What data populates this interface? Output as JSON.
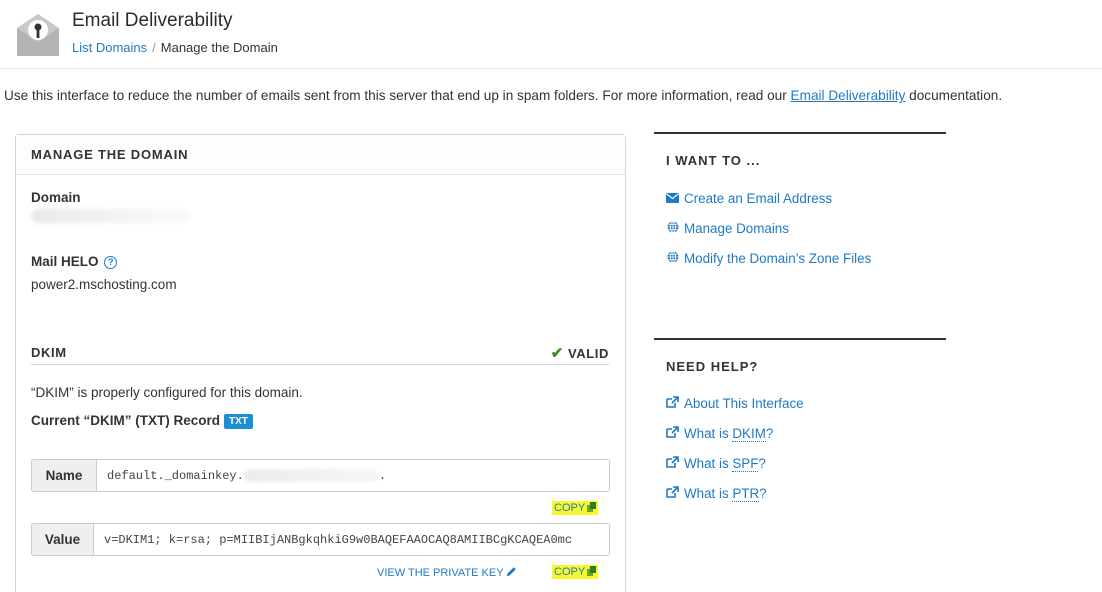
{
  "header": {
    "title": "Email Deliverability",
    "breadcrumb": {
      "link": "List Domains",
      "separator": "/",
      "current": "Manage the Domain"
    }
  },
  "intro": {
    "text_before": "Use this interface to reduce the number of emails sent from this server that end up in spam folders. For more information, read our ",
    "link": "Email Deliverability",
    "text_after": " documentation."
  },
  "panel": {
    "title": "MANAGE THE DOMAIN",
    "domain_label": "Domain",
    "mail_helo_label": "Mail HELO",
    "help_icon": "?",
    "mail_helo_value": "power2.mschosting.com",
    "dkim": {
      "title": "DKIM",
      "status": "VALID",
      "check_icon": "✔",
      "message": "“DKIM” is properly configured for this domain.",
      "record_label": "Current “DKIM” (TXT) Record",
      "record_badge": "TXT",
      "name_label": "Name",
      "name_value_prefix": "default._domainkey.",
      "name_value_suffix": ".",
      "value_label": "Value",
      "value_text": "v=DKIM1; k=rsa; p=MIIBIjANBgkqhkiG9w0BAQEFAAOCAQ8AMIIBCgKCAQEA0mc",
      "copy_label": "COPY",
      "view_private_key": "VIEW THE PRIVATE KEY"
    }
  },
  "side": {
    "want_title": "I WANT TO ...",
    "want_links": [
      {
        "label": "Create an Email Address",
        "icon": "envelope-icon"
      },
      {
        "label": "Manage Domains",
        "icon": "globe-icon"
      },
      {
        "label": "Modify the Domain’s Zone Files",
        "icon": "globe-icon"
      }
    ],
    "help_title": "NEED HELP?",
    "help_links": {
      "about": "About This Interface",
      "what_is": "What is ",
      "dkim": "DKIM",
      "spf": "SPF",
      "ptr": "PTR",
      "q": "?"
    }
  },
  "colors": {
    "link": "#1f7ac4",
    "valid": "#3c8c28",
    "badge": "#1b8fd6",
    "copy_highlight": "#f7f72a"
  }
}
